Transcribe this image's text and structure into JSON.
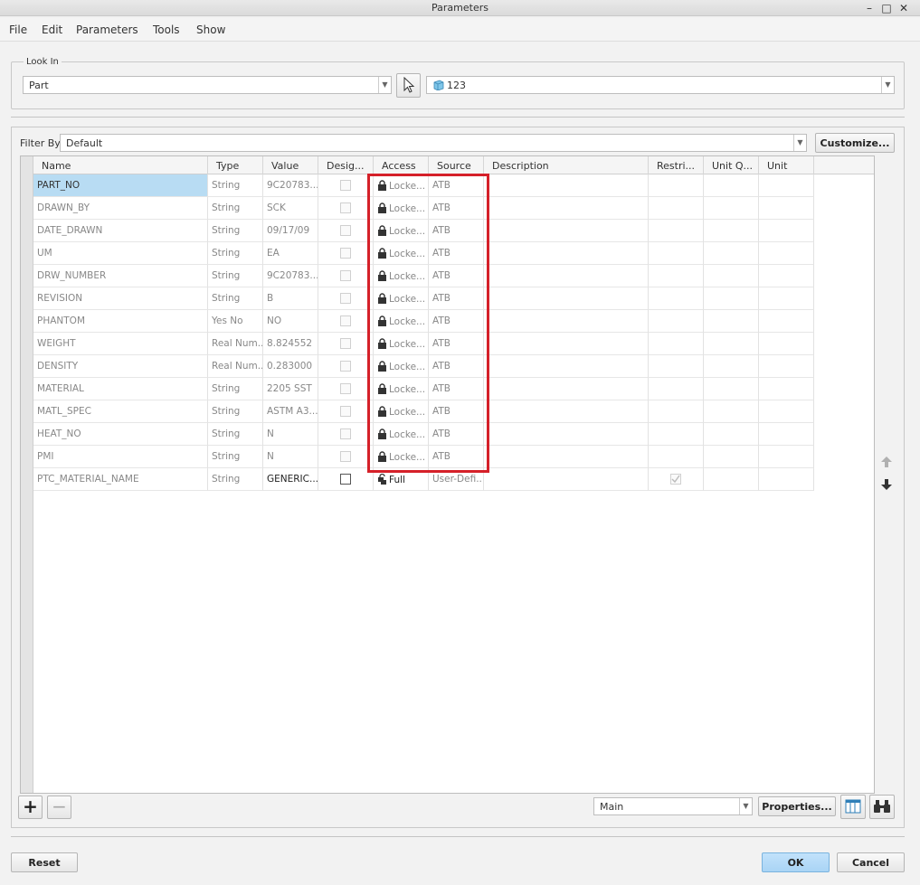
{
  "window": {
    "title": "Parameters",
    "controls": [
      "–",
      "□",
      "✕"
    ]
  },
  "menu": [
    "File",
    "Edit",
    "Parameters",
    "Tools",
    "Show"
  ],
  "look_in": {
    "legend": "Look In",
    "scope": "Part",
    "model": "123",
    "pick_icon": "pointer-icon"
  },
  "filter": {
    "label": "Filter By",
    "value": "Default",
    "customize_label": "Customize..."
  },
  "columns": [
    "Name",
    "Type",
    "Value",
    "Desig...",
    "Access",
    "Source",
    "Description",
    "Restri...",
    "Unit Q...",
    "Unit"
  ],
  "rows": [
    {
      "name": "PART_NO",
      "type": "String",
      "value": "9C20783...",
      "access": "Locke...",
      "source": "ATB"
    },
    {
      "name": "DRAWN_BY",
      "type": "String",
      "value": "SCK",
      "access": "Locke...",
      "source": "ATB"
    },
    {
      "name": "DATE_DRAWN",
      "type": "String",
      "value": "09/17/09",
      "access": "Locke...",
      "source": "ATB"
    },
    {
      "name": "UM",
      "type": "String",
      "value": "EA",
      "access": "Locke...",
      "source": "ATB"
    },
    {
      "name": "DRW_NUMBER",
      "type": "String",
      "value": "9C20783...",
      "access": "Locke...",
      "source": "ATB"
    },
    {
      "name": "REVISION",
      "type": "String",
      "value": "B",
      "access": "Locke...",
      "source": "ATB"
    },
    {
      "name": "PHANTOM",
      "type": "Yes No",
      "value": "NO",
      "access": "Locke...",
      "source": "ATB"
    },
    {
      "name": "WEIGHT",
      "type": "Real Num...",
      "value": "8.824552",
      "access": "Locke...",
      "source": "ATB"
    },
    {
      "name": "DENSITY",
      "type": "Real Num...",
      "value": "0.283000",
      "access": "Locke...",
      "source": "ATB"
    },
    {
      "name": "MATERIAL",
      "type": "String",
      "value": "2205 SST",
      "access": "Locke...",
      "source": "ATB"
    },
    {
      "name": "MATL_SPEC",
      "type": "String",
      "value": "ASTM A3...",
      "access": "Locke...",
      "source": "ATB"
    },
    {
      "name": "HEAT_NO",
      "type": "String",
      "value": "N",
      "access": "Locke...",
      "source": "ATB"
    },
    {
      "name": "PMI",
      "type": "String",
      "value": "N",
      "access": "Locke...",
      "source": "ATB"
    },
    {
      "name": "PTC_MATERIAL_NAME",
      "type": "String",
      "value": "GENERIC...",
      "access": "Full",
      "source": "User-Defi..."
    }
  ],
  "bottom": {
    "add": "+",
    "remove": "−",
    "view": "Main",
    "properties_label": "Properties..."
  },
  "footer": {
    "reset_label": "Reset",
    "ok_label": "OK",
    "cancel_label": "Cancel"
  },
  "colors": {
    "selection": "#b8dcf3",
    "highlight_box": "#d52029",
    "ok_button": "#a9d4f5"
  }
}
